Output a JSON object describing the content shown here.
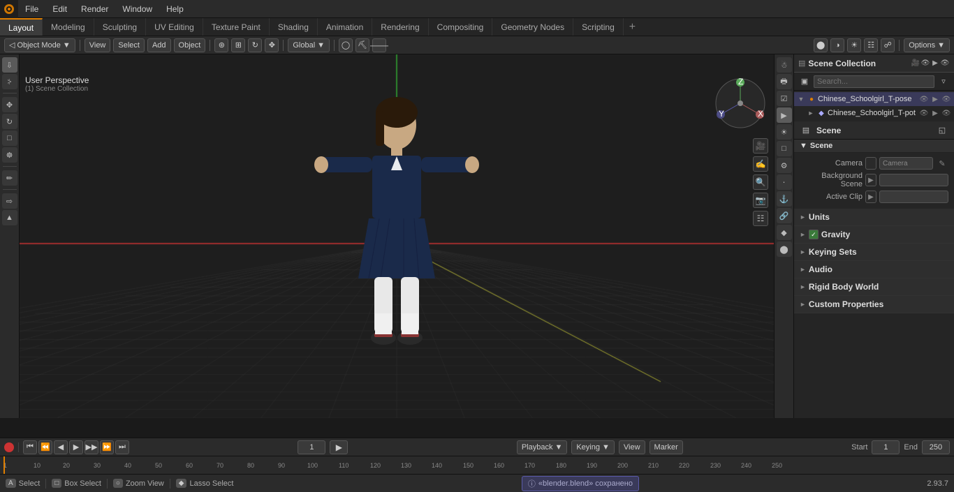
{
  "app": {
    "title": "Blender",
    "version": "2.93.7"
  },
  "top_menu": {
    "items": [
      "File",
      "Edit",
      "Render",
      "Window",
      "Help"
    ]
  },
  "workspace_tabs": {
    "tabs": [
      "Layout",
      "Modeling",
      "Sculpting",
      "UV Editing",
      "Texture Paint",
      "Shading",
      "Animation",
      "Rendering",
      "Compositing",
      "Geometry Nodes",
      "Scripting"
    ],
    "active": "Layout",
    "add_label": "+"
  },
  "viewport_header": {
    "mode_label": "Object Mode",
    "view_label": "View",
    "select_label": "Select",
    "add_label": "Add",
    "object_label": "Object",
    "transform_label": "Global",
    "options_label": "Options"
  },
  "viewport": {
    "breadcrumb_main": "User Perspective",
    "breadcrumb_sub": "(1) Scene Collection"
  },
  "outliner": {
    "title": "Scene Collection",
    "items": [
      {
        "label": "Chinese_Schoolgirl_T-pose",
        "indent": 0,
        "expanded": true,
        "icon": "mesh"
      },
      {
        "label": "Chinese_Schoolgirl_T-pot",
        "indent": 1,
        "expanded": false,
        "icon": "armature"
      }
    ]
  },
  "properties": {
    "active_tab": "scene",
    "tabs": [
      "render",
      "output",
      "view_layer",
      "scene",
      "world",
      "object",
      "modifiers",
      "particles",
      "physics",
      "constraints",
      "data",
      "material",
      "shading"
    ],
    "header_label": "Scene",
    "section_scene": {
      "label": "Scene",
      "expanded": true,
      "camera_label": "Camera",
      "camera_value": "",
      "background_scene_label": "Background Scene",
      "background_scene_value": "",
      "active_clip_label": "Active Clip",
      "active_clip_value": ""
    },
    "section_units": {
      "label": "Units",
      "expanded": false
    },
    "section_gravity": {
      "label": "Gravity",
      "expanded": false,
      "checkbox": true
    },
    "section_keying_sets": {
      "label": "Keying Sets",
      "expanded": false
    },
    "section_audio": {
      "label": "Audio",
      "expanded": false
    },
    "section_rigid_body_world": {
      "label": "Rigid Body World",
      "expanded": false
    },
    "section_custom_properties": {
      "label": "Custom Properties",
      "expanded": false
    }
  },
  "timeline": {
    "playback_label": "Playback",
    "keying_label": "Keying",
    "view_label": "View",
    "marker_label": "Marker",
    "current_frame": "1",
    "start_label": "Start",
    "start_value": "1",
    "end_label": "End",
    "end_value": "250",
    "frame_marks": [
      "1",
      "10",
      "20",
      "30",
      "40",
      "50",
      "60",
      "70",
      "80",
      "90",
      "100",
      "110",
      "120",
      "130",
      "140",
      "150",
      "160",
      "170",
      "180",
      "190",
      "200",
      "210",
      "220",
      "230",
      "240",
      "250"
    ]
  },
  "status_bar": {
    "select_label": "Select",
    "select_shortcut": "A",
    "box_select_label": "Box Select",
    "zoom_label": "Zoom View",
    "lasso_label": "Lasso Select",
    "info_icon": "i",
    "notification": "«blender.blend» сохранено",
    "version": "2.93.7"
  }
}
